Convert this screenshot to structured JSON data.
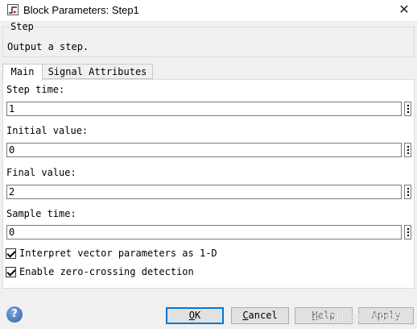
{
  "window": {
    "title": "Block Parameters: Step1",
    "icon": "simulink-block-icon",
    "close_glyph": "✕"
  },
  "block_group": {
    "name": "Step",
    "description": "Output a step."
  },
  "tabs": [
    {
      "label": "Main",
      "selected": true
    },
    {
      "label": "Signal Attributes",
      "selected": false
    }
  ],
  "params": {
    "step_time": {
      "label": "Step time:",
      "value": "1"
    },
    "initial_value": {
      "label": "Initial value:",
      "value": "0"
    },
    "final_value": {
      "label": "Final value:",
      "value": "2"
    },
    "sample_time": {
      "label": "Sample time:",
      "value": "0"
    }
  },
  "checkboxes": {
    "interpret_vector": {
      "label": "Interpret vector parameters as 1-D",
      "checked": true
    },
    "zero_crossing": {
      "label": "Enable zero-crossing detection",
      "checked": true
    }
  },
  "buttons": {
    "ok": {
      "mnemonic": "O",
      "rest": "K"
    },
    "cancel": {
      "mnemonic": "C",
      "rest": "ancel"
    },
    "help": {
      "mnemonic": "H",
      "rest": "elp"
    },
    "apply": {
      "label": "Apply"
    },
    "help_icon": "?"
  },
  "watermark": "CSDN @唱跳ROS",
  "colors": {
    "dialog_bg": "#f0f0f0",
    "panel_bg": "#ffffff",
    "default_button_border": "#0078d7",
    "help_icon": "#2f5fa8"
  }
}
